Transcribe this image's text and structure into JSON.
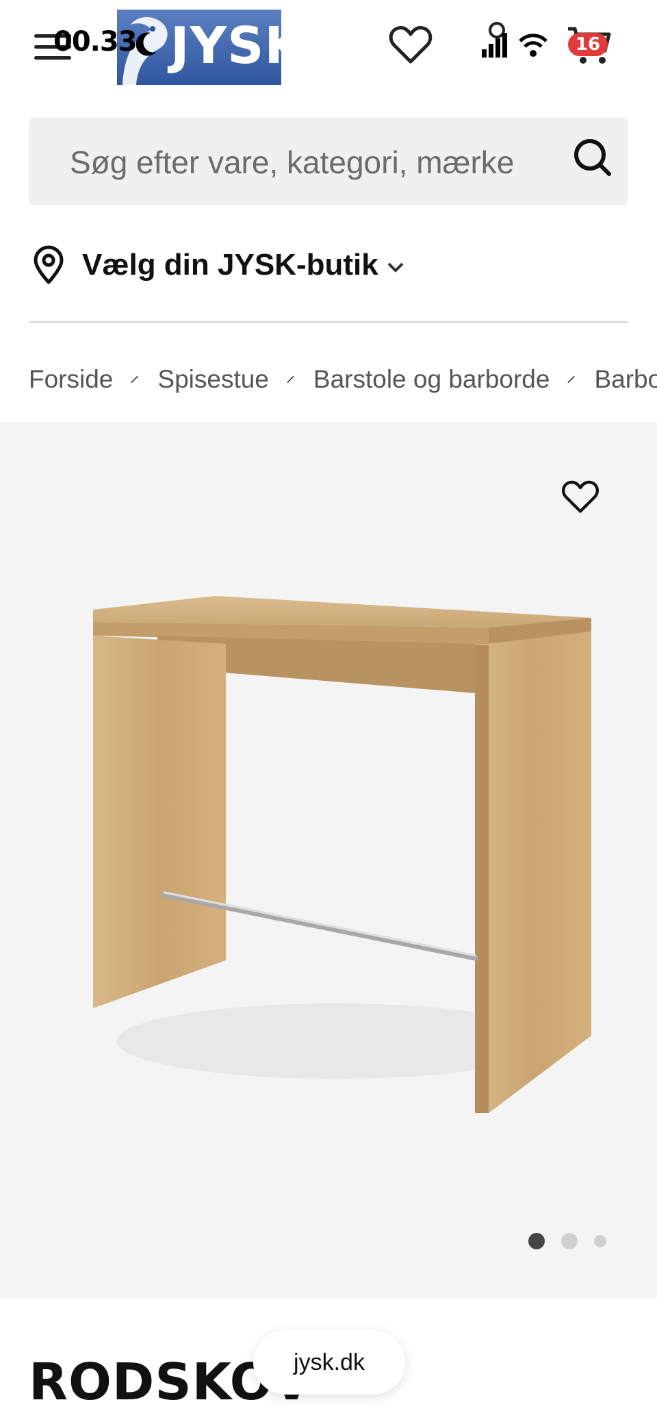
{
  "status_bar": {
    "time": "00.33",
    "cart_count": "16"
  },
  "header": {
    "logo_text": "JYSK",
    "icons": [
      "menu-icon",
      "heart-icon",
      "cart-icon"
    ]
  },
  "search": {
    "placeholder": "Søg efter vare, kategori, mærke"
  },
  "store_selector": {
    "label": "Vælg din JYSK-butik"
  },
  "breadcrumb": [
    "Forside",
    "Spisestue",
    "Barstole og barborde",
    "Barborde"
  ],
  "gallery": {
    "slide_count": 3,
    "active_slide": 1
  },
  "product": {
    "title": "RODSKOV"
  },
  "browser": {
    "url": "jysk.dk"
  },
  "colors": {
    "brand_blue": "#2f56a0",
    "gallery_bg": "#f4f4f4",
    "badge_red": "#e23a3a"
  }
}
